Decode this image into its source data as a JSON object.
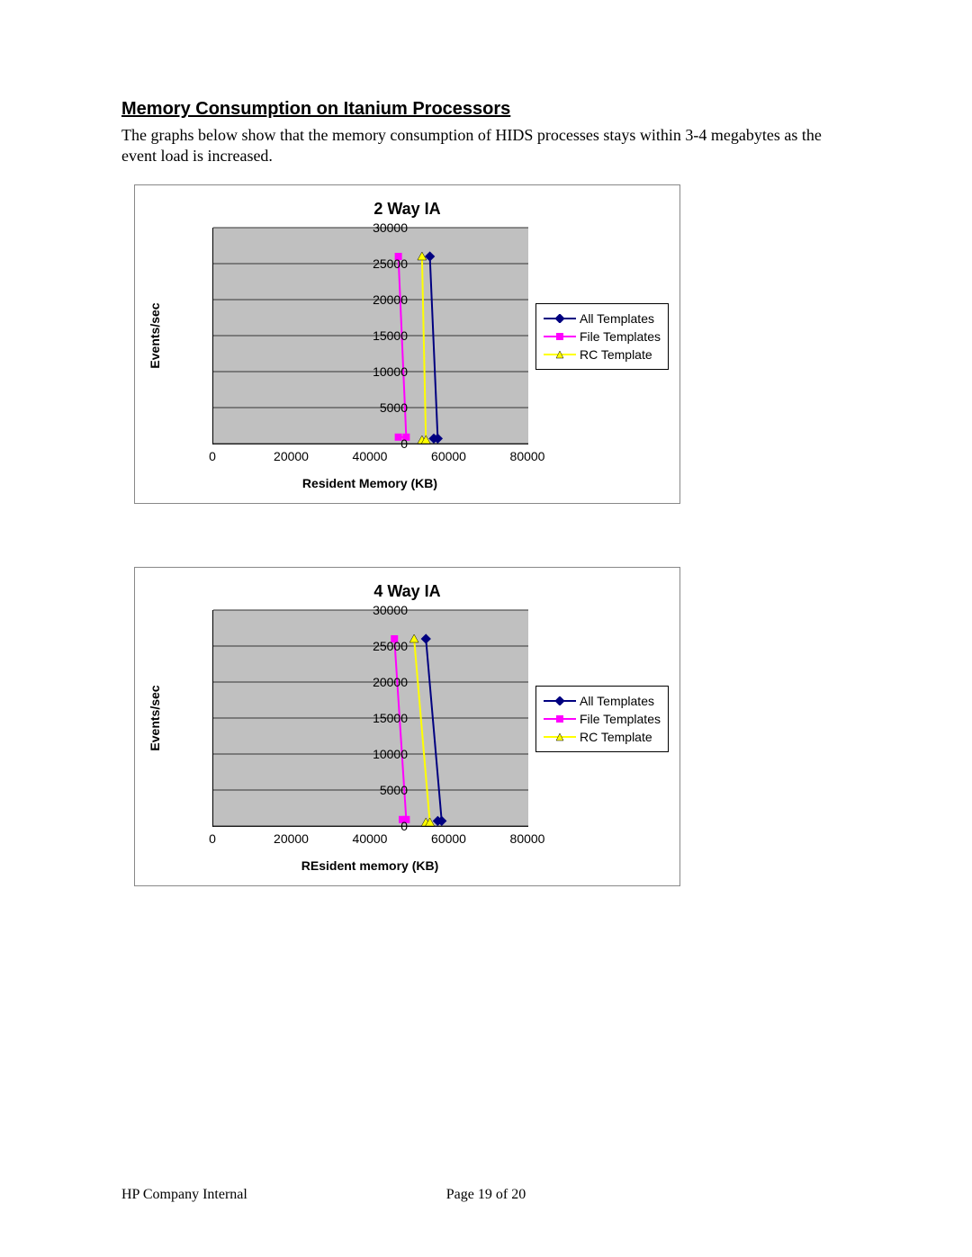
{
  "heading": "Memory Consumption on Itanium Processors",
  "paragraph": "The graphs below show that the memory consumption of HIDS processes stays within 3-4 megabytes as the event load is increased.",
  "footer": {
    "left": "HP Company Internal",
    "page": "Page 19 of 20"
  },
  "chart_data": [
    {
      "type": "line",
      "title": "2 Way IA",
      "xlabel": "Resident Memory (KB)",
      "ylabel": "Events/sec",
      "xlim": [
        0,
        80000
      ],
      "ylim": [
        0,
        30000
      ],
      "xticks": [
        0,
        20000,
        40000,
        60000,
        80000
      ],
      "yticks": [
        0,
        5000,
        10000,
        15000,
        20000,
        25000,
        30000
      ],
      "series": [
        {
          "name": "All Templates",
          "color": "#000080",
          "marker": "diamond",
          "points": [
            {
              "x": 56000,
              "y": 700
            },
            {
              "x": 57000,
              "y": 700
            },
            {
              "x": 55000,
              "y": 26000
            }
          ]
        },
        {
          "name": "File Templates",
          "color": "#ff00ff",
          "marker": "square",
          "points": [
            {
              "x": 47000,
              "y": 900
            },
            {
              "x": 49000,
              "y": 900
            },
            {
              "x": 47000,
              "y": 26000
            }
          ]
        },
        {
          "name": "RC Template",
          "color": "#ffff00",
          "marker": "triangle",
          "points": [
            {
              "x": 53000,
              "y": 500
            },
            {
              "x": 54000,
              "y": 500
            },
            {
              "x": 53000,
              "y": 26000
            }
          ]
        }
      ]
    },
    {
      "type": "line",
      "title": "4 Way IA",
      "xlabel": "REsident memory (KB)",
      "ylabel": "Events/sec",
      "xlim": [
        0,
        80000
      ],
      "ylim": [
        0,
        30000
      ],
      "xticks": [
        0,
        20000,
        40000,
        60000,
        80000
      ],
      "yticks": [
        0,
        5000,
        10000,
        15000,
        20000,
        25000,
        30000
      ],
      "series": [
        {
          "name": "All Templates",
          "color": "#000080",
          "marker": "diamond",
          "points": [
            {
              "x": 57000,
              "y": 700
            },
            {
              "x": 58000,
              "y": 700
            },
            {
              "x": 54000,
              "y": 26000
            }
          ]
        },
        {
          "name": "File Templates",
          "color": "#ff00ff",
          "marker": "square",
          "points": [
            {
              "x": 48000,
              "y": 900
            },
            {
              "x": 49000,
              "y": 900
            },
            {
              "x": 46000,
              "y": 26000
            }
          ]
        },
        {
          "name": "RC Template",
          "color": "#ffff00",
          "marker": "triangle",
          "points": [
            {
              "x": 54000,
              "y": 500
            },
            {
              "x": 55000,
              "y": 500
            },
            {
              "x": 51000,
              "y": 26000
            }
          ]
        }
      ]
    }
  ]
}
